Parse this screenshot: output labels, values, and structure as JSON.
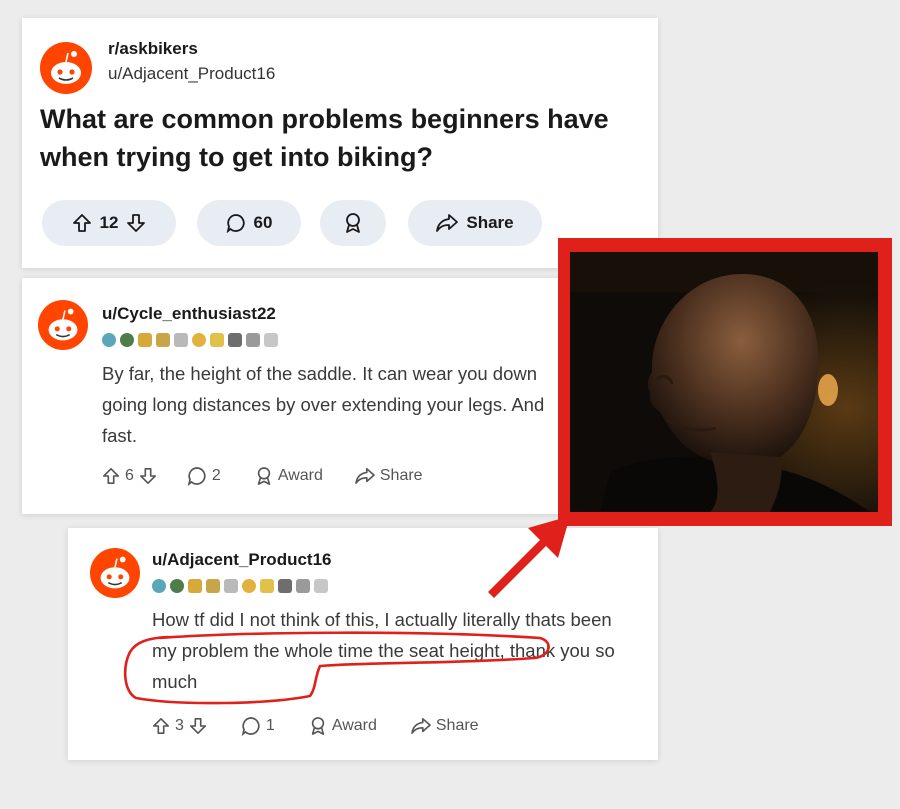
{
  "post": {
    "subreddit": "r/askbikers",
    "author": "u/Adjacent_Product16",
    "title": "What are common problems beginners have when trying to get into biking?",
    "votes": "12",
    "comments": "60",
    "share_label": "Share"
  },
  "comments": [
    {
      "author": "u/Cycle_enthusiast22",
      "body": "By far, the height of the saddle. It can wear you down going long distances by over extending your legs. And fast.",
      "votes": "6",
      "replies": "2",
      "award_label": "Award",
      "share_label": "Share"
    },
    {
      "author": "u/Adjacent_Product16",
      "body": "How tf did I not think of this, I actually literally thats been my problem the whole time the seat height, thank you so much",
      "votes": "3",
      "replies": "1",
      "award_label": "Award",
      "share_label": "Share"
    }
  ],
  "colors": {
    "reddit_orange": "#ff4500",
    "highlight_red": "#e0201a",
    "pill_bg": "#e8ecf3"
  },
  "icons": [
    "reddit-avatar-icon",
    "upvote-icon",
    "downvote-icon",
    "comment-icon",
    "award-icon",
    "share-icon",
    "badge-icon"
  ]
}
